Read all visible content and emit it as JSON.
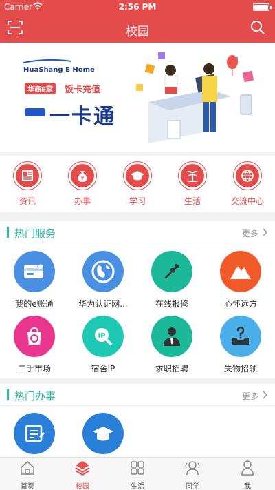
{
  "status": {
    "carrier": "Carrier",
    "time": "2:56 PM"
  },
  "nav": {
    "title": "校园"
  },
  "banner": {
    "brand": "HuaShang E Home",
    "badge": "华商E家",
    "slogan": "饭卡充值",
    "title": "一卡通"
  },
  "quick": [
    {
      "label": "资讯",
      "icon": "news-icon"
    },
    {
      "label": "办事",
      "icon": "money-bag-icon"
    },
    {
      "label": "学习",
      "icon": "graduation-cap-icon"
    },
    {
      "label": "生活",
      "icon": "palm-tree-icon"
    },
    {
      "label": "交流中心",
      "icon": "globe-icon"
    }
  ],
  "hot_services": {
    "title": "热门服务",
    "more": "更多",
    "items": [
      {
        "label": "我的e账通",
        "icon": "card-icon",
        "color": "#4a90e2"
      },
      {
        "label": "华为认证网...",
        "icon": "globe-icon",
        "color": "#4a90e2"
      },
      {
        "label": "在线报修",
        "icon": "wrench-icon",
        "color": "#1bb89a"
      },
      {
        "label": "心怀远方",
        "icon": "mountain-icon",
        "color": "#f05a28"
      },
      {
        "label": "二手市场",
        "icon": "recycle-bag-icon",
        "color": "#e8368f"
      },
      {
        "label": "宿舍IP",
        "icon": "ip-search-icon",
        "color": "#1ec9b3"
      },
      {
        "label": "求职招聘",
        "icon": "person-tie-icon",
        "color": "#1bb89a"
      },
      {
        "label": "失物招领",
        "icon": "lost-found-icon",
        "color": "#4aaee8"
      }
    ]
  },
  "hot_affairs": {
    "title": "热门办事",
    "more": "更多",
    "items": [
      {
        "icon": "form-icon",
        "color": "#2a7fd8"
      },
      {
        "icon": "graduation-cap-icon",
        "color": "#2a7fd8"
      }
    ]
  },
  "tabs": [
    {
      "label": "首页",
      "icon": "home-icon"
    },
    {
      "label": "校园",
      "icon": "layers-icon",
      "active": true
    },
    {
      "label": "生活",
      "icon": "grid-icon"
    },
    {
      "label": "同学",
      "icon": "classmates-icon"
    },
    {
      "label": "我",
      "icon": "user-icon"
    }
  ],
  "colors": {
    "brand_red": "#e44b4b",
    "accent_teal": "#27b8a8"
  }
}
